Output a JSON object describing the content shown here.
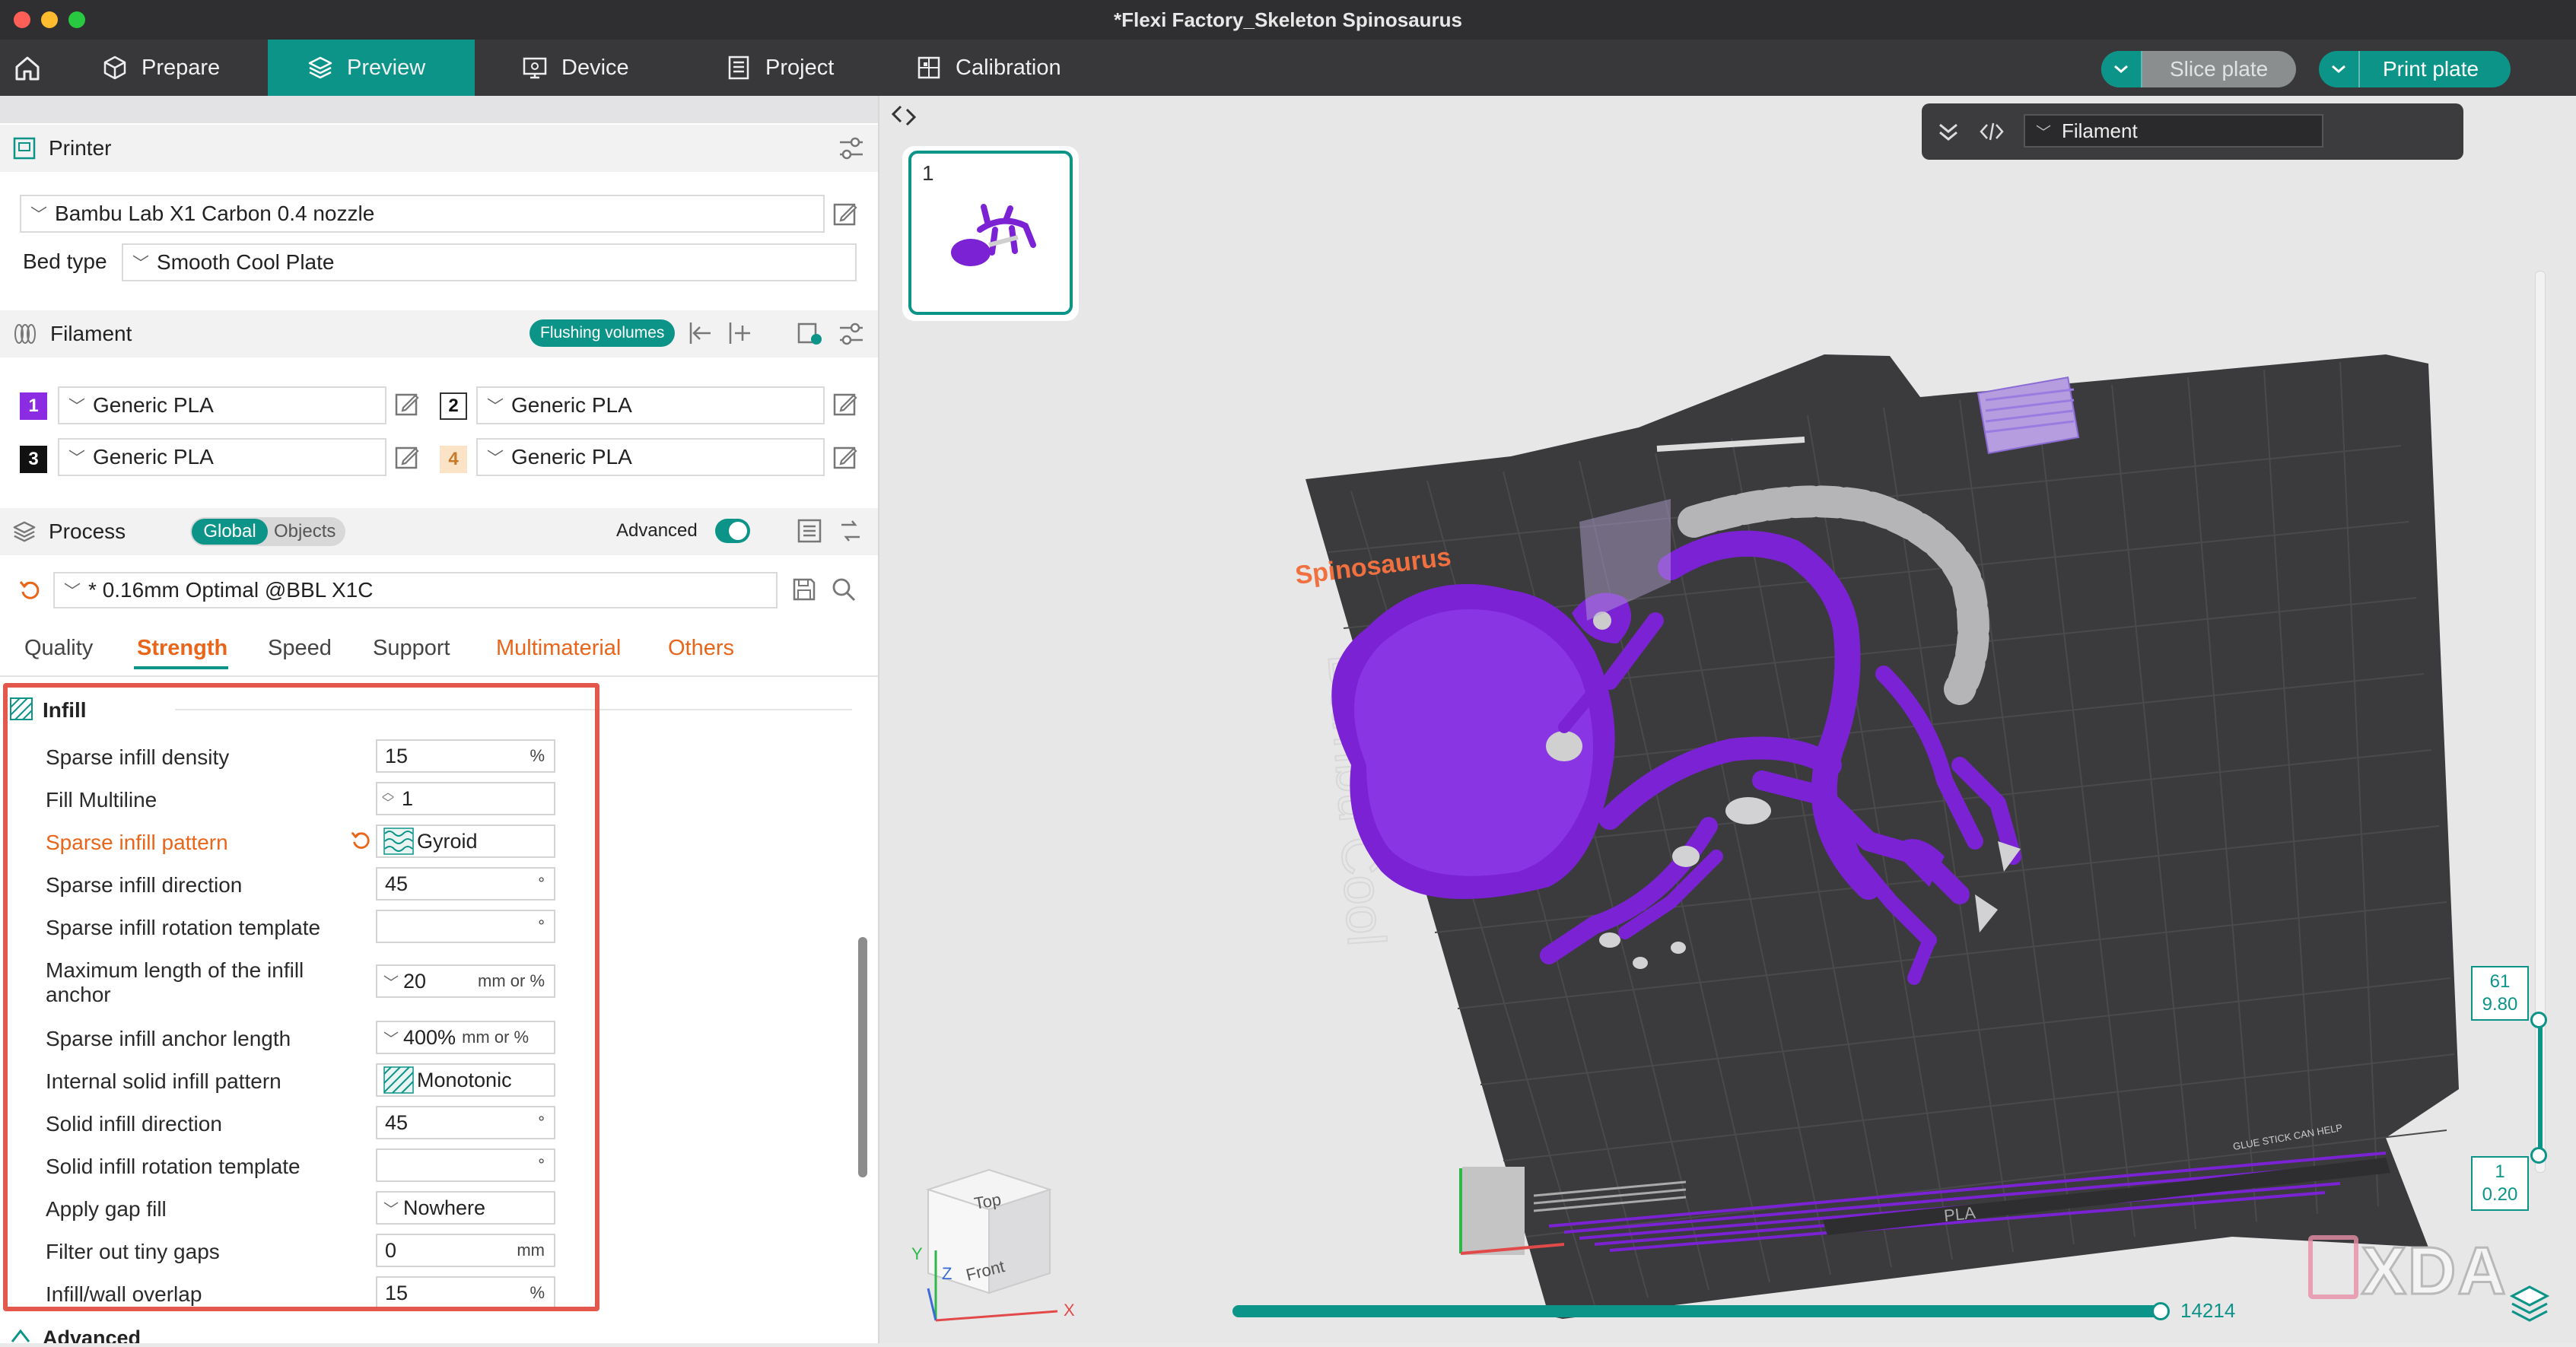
{
  "window": {
    "title": "*Flexi Factory_Skeleton Spinosaurus"
  },
  "nav": {
    "tabs": [
      {
        "label": "Prepare",
        "icon": "cube-icon"
      },
      {
        "label": "Preview",
        "icon": "layers-icon",
        "active": true
      },
      {
        "label": "Device",
        "icon": "monitor-icon"
      },
      {
        "label": "Project",
        "icon": "document-icon"
      },
      {
        "label": "Calibration",
        "icon": "calibration-icon"
      }
    ],
    "slice_label": "Slice plate",
    "print_label": "Print plate"
  },
  "printer": {
    "section_label": "Printer",
    "model": "Bambu Lab X1 Carbon 0.4 nozzle",
    "bed_type_label": "Bed type",
    "bed_type": "Smooth Cool Plate"
  },
  "filament": {
    "section_label": "Filament",
    "flushing_label": "Flushing volumes",
    "slots": [
      {
        "num": "1",
        "name": "Generic PLA",
        "color": "#8b2be2"
      },
      {
        "num": "2",
        "name": "Generic PLA",
        "color": "#ffffff"
      },
      {
        "num": "3",
        "name": "Generic PLA",
        "color": "#111111"
      },
      {
        "num": "4",
        "name": "Generic PLA",
        "color": "#fbe3c8"
      }
    ]
  },
  "process": {
    "section_label": "Process",
    "global_label": "Global",
    "objects_label": "Objects",
    "advanced_label": "Advanced",
    "advanced_on": true,
    "profile": "* 0.16mm Optimal @BBL X1C",
    "tabs": [
      "Quality",
      "Strength",
      "Speed",
      "Support",
      "Multimaterial",
      "Others"
    ],
    "active_tab": "Strength"
  },
  "infill": {
    "heading": "Infill",
    "rows": [
      {
        "label": "Sparse infill density",
        "value": "15",
        "unit": "%"
      },
      {
        "label": "Fill Multiline",
        "value": "1",
        "unit": ""
      },
      {
        "label": "Sparse infill pattern",
        "value": "Gyroid",
        "unit": ""
      },
      {
        "label": "Sparse infill direction",
        "value": "45",
        "unit": "°"
      },
      {
        "label": "Sparse infill rotation template",
        "value": "",
        "unit": "°"
      },
      {
        "label": "Maximum length of the infill",
        "label2": "anchor",
        "value": "20",
        "unit": "mm or %"
      },
      {
        "label": "Sparse infill anchor length",
        "value": "400%",
        "unit": "mm or %"
      },
      {
        "label": "Internal solid infill pattern",
        "value": "Monotonic",
        "unit": ""
      },
      {
        "label": "Solid infill direction",
        "value": "45",
        "unit": "°"
      },
      {
        "label": "Solid infill rotation template",
        "value": "",
        "unit": "°"
      },
      {
        "label": "Apply gap fill",
        "value": "Nowhere",
        "unit": ""
      },
      {
        "label": "Filter out tiny gaps",
        "value": "0",
        "unit": "mm"
      },
      {
        "label": "Infill/wall overlap",
        "value": "15",
        "unit": "%"
      }
    ],
    "next_heading": "Advanced"
  },
  "viewport": {
    "plate_number": "1",
    "view_mode": "Filament",
    "plate_label": "Spinosaurus",
    "bed_text": "Bambu Cool",
    "bed_logo_text": "PLA",
    "glue_text": "GLUE STICK CAN HELP",
    "cube_top": "Top",
    "cube_front": "Front",
    "axis_x": "X",
    "axis_y": "Y",
    "axis_z": "Z",
    "layer_top": "61",
    "layer_top_height": "9.80",
    "layer_bottom": "1",
    "layer_bottom_height": "0.20",
    "move_count": "14214",
    "watermark": "XDA",
    "colors": {
      "purple": "#7a22d4",
      "teal": "#0d9488",
      "bed": "#3b3b3d"
    }
  }
}
